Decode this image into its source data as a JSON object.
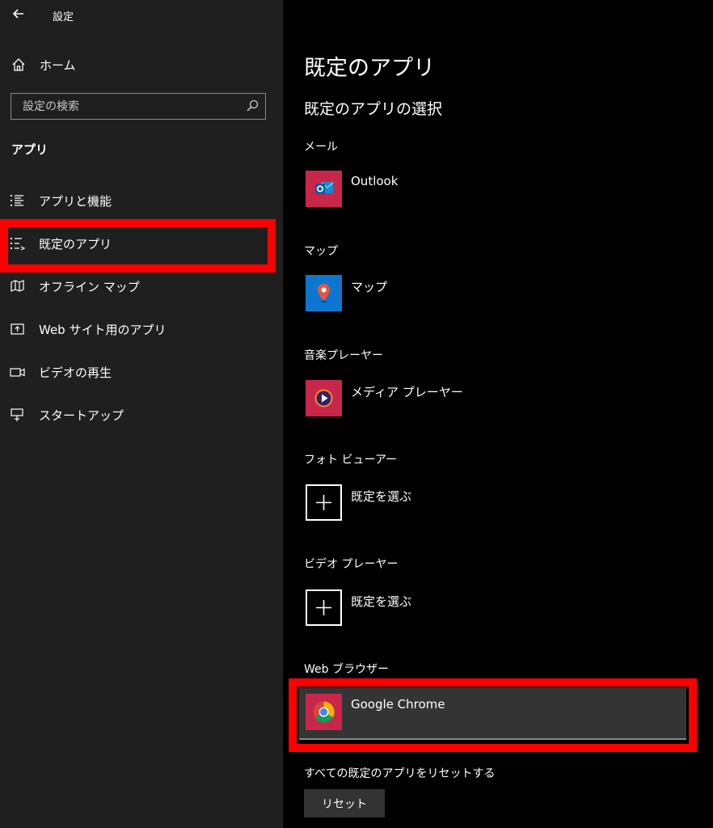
{
  "window": {
    "title": "設定"
  },
  "sidebar": {
    "home_label": "ホーム",
    "search_placeholder": "設定の検索",
    "section_title": "アプリ",
    "items": [
      {
        "label": "アプリと機能",
        "icon": "list-icon"
      },
      {
        "label": "既定のアプリ",
        "icon": "default-apps-icon"
      },
      {
        "label": "オフライン マップ",
        "icon": "offline-map-icon"
      },
      {
        "label": "Web サイト用のアプリ",
        "icon": "web-app-icon"
      },
      {
        "label": "ビデオの再生",
        "icon": "video-icon"
      },
      {
        "label": "スタートアップ",
        "icon": "startup-icon"
      }
    ]
  },
  "main": {
    "title": "既定のアプリ",
    "subtitle": "既定のアプリの選択",
    "categories": [
      {
        "label": "メール",
        "app": "Outlook",
        "icon": "outlook-icon"
      },
      {
        "label": "マップ",
        "app": "マップ",
        "icon": "maps-icon"
      },
      {
        "label": "音楽プレーヤー",
        "app": "メディア プレーヤー",
        "icon": "media-player-icon"
      },
      {
        "label": "フォト ビューアー",
        "app": "既定を選ぶ",
        "icon": "plus-icon"
      },
      {
        "label": "ビデオ プレーヤー",
        "app": "既定を選ぶ",
        "icon": "plus-icon"
      },
      {
        "label": "Web ブラウザー",
        "app": "Google Chrome",
        "icon": "chrome-icon"
      }
    ],
    "reset_label": "すべての既定のアプリをリセットする",
    "reset_button": "リセット"
  },
  "colors": {
    "sidebar_bg": "#1f1f1f",
    "main_bg": "#000000",
    "highlight": "#ff0000",
    "tile_red": "#c8274a",
    "tile_blue": "#0f76d0"
  }
}
